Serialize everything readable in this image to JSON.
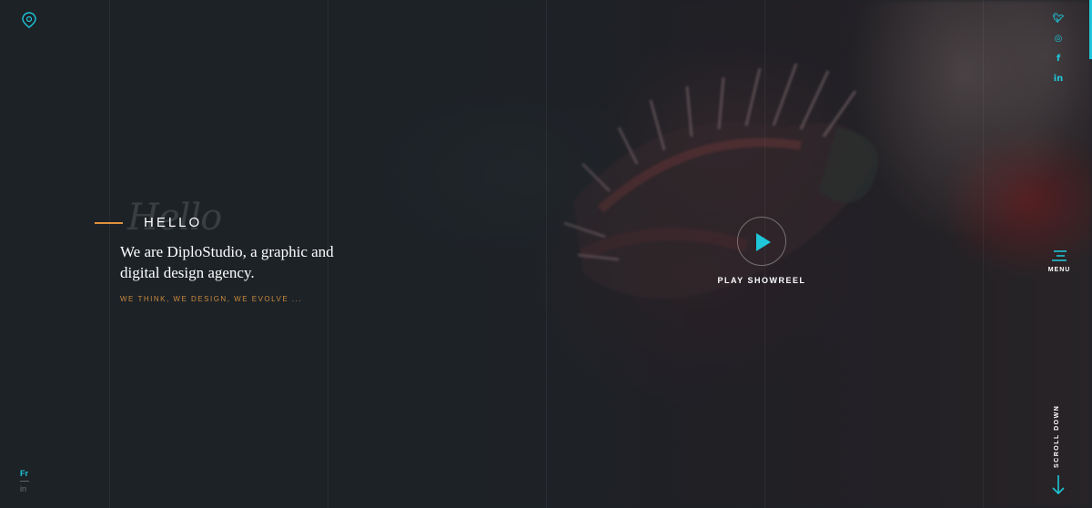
{
  "brand": {
    "logo_icon": "pin-logo-icon",
    "accent_color": "#1fc6d9",
    "highlight_color": "#e0913e"
  },
  "social": [
    {
      "name": "twitter",
      "glyph": "🐦︎"
    },
    {
      "name": "instagram",
      "glyph": "◎"
    },
    {
      "name": "facebook",
      "glyph": "f"
    },
    {
      "name": "linkedin",
      "glyph": "in"
    }
  ],
  "hero": {
    "ghost_text": "Hello",
    "hello_label": "HELLO",
    "tagline": "We are DiploStudio, a graphic and digital design agency.",
    "slogan": "WE THINK, WE DESIGN, WE EVOLVE ..."
  },
  "showreel": {
    "label": "PLAY SHOWREEL"
  },
  "menu": {
    "label": "MENU"
  },
  "scroll": {
    "label": "SCROLL DOWN"
  },
  "language": {
    "current": "Fr",
    "alternate": "in"
  }
}
